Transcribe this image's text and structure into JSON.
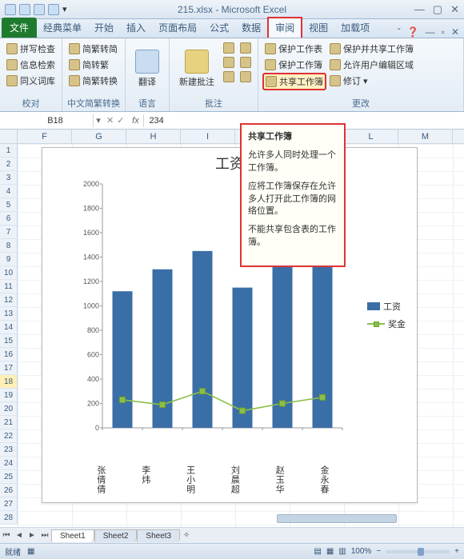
{
  "title": "215.xlsx - Microsoft Excel",
  "tabs": {
    "file": "文件",
    "classic": "经典菜单",
    "home": "开始",
    "insert": "插入",
    "layout": "页面布局",
    "formulas": "公式",
    "data": "数据",
    "review": "审阅",
    "view": "视图",
    "addins": "加载项"
  },
  "ribbon": {
    "proof": {
      "spell": "拼写检查",
      "research": "信息检索",
      "thesaurus": "同义词库",
      "label": "校对"
    },
    "chinese": {
      "t2s": "简繁转简",
      "s2t": "简转繁",
      "conv": "简繁转换",
      "label": "中文简繁转换"
    },
    "lang": {
      "btn": "翻译",
      "label": "语言"
    },
    "comments": {
      "new": "新建批注",
      "label": "批注"
    },
    "changes": {
      "protectSheet": "保护工作表",
      "protectWb": "保护并共享工作簿",
      "protectBook": "保护工作簿",
      "allowEdit": "允许用户编辑区域",
      "shareWb": "共享工作簿",
      "track": "修订",
      "label": "更改"
    }
  },
  "namebox": "B18",
  "fxvalue": "234",
  "cols": [
    "F",
    "G",
    "H",
    "I",
    "J",
    "K",
    "L",
    "M"
  ],
  "rowStart": 1,
  "rowEnd": 28,
  "selectedRow": 18,
  "chart_data": {
    "type": "combo",
    "title": "工资",
    "categories": [
      "张倩倩",
      "李炜",
      "王小明",
      "刘晨超",
      "赵玉华",
      "金永春"
    ],
    "series": [
      {
        "name": "工资",
        "type": "bar",
        "values": [
          1120,
          1300,
          1450,
          1150,
          1600,
          1340
        ]
      },
      {
        "name": "奖金",
        "type": "line",
        "values": [
          230,
          190,
          300,
          140,
          200,
          250
        ]
      }
    ],
    "ylim": [
      0,
      2000
    ],
    "ystep": 200,
    "legend_position": "right"
  },
  "popup": {
    "title": "共享工作簿",
    "p1": "允许多人同时处理一个工作簿。",
    "p2": "应将工作簿保存在允许多人打开此工作簿的网络位置。",
    "p3": "不能共享包含表的工作簿。"
  },
  "sheets": {
    "s1": "Sheet1",
    "s2": "Sheet2",
    "s3": "Sheet3"
  },
  "status": {
    "ready": "就绪",
    "zoom": "100%"
  }
}
